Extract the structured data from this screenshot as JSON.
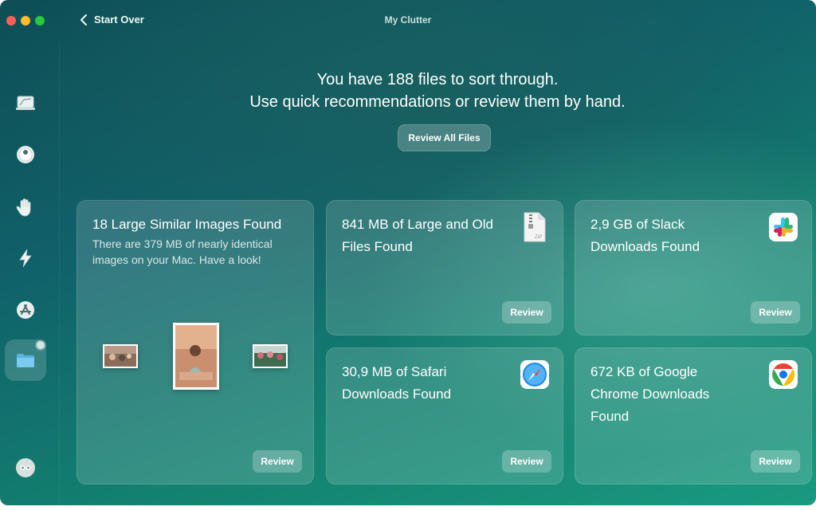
{
  "window": {
    "title": "My Clutter",
    "back_label": "Start Over"
  },
  "sidebar": {
    "items": [
      {
        "name": "smart-scan",
        "icon": "monitor-icon"
      },
      {
        "name": "cleanup",
        "icon": "disk-icon"
      },
      {
        "name": "protection",
        "icon": "hand-icon"
      },
      {
        "name": "performance",
        "icon": "bolt-icon"
      },
      {
        "name": "applications",
        "icon": "app-store-icon"
      },
      {
        "name": "my-clutter",
        "icon": "folder-icon",
        "active": true
      },
      {
        "name": "assistant",
        "icon": "assistant-icon"
      }
    ]
  },
  "header": {
    "line1": "You have 188 files to sort through.",
    "line2": "Use quick recommendations or review them by hand.",
    "review_all_label": "Review All Files"
  },
  "cards": [
    {
      "title": "18 Large Similar Images Found",
      "subtitle_line1": "There are 379 MB of nearly identical",
      "subtitle_line2": "images on your Mac. Have a look!",
      "button": "Review"
    },
    {
      "title_line1": "841 MB of Large and Old",
      "title_line2": "Files Found",
      "icon": "zip-file-icon",
      "button": "Review"
    },
    {
      "title_line1": "2,9 GB of Slack",
      "title_line2": "Downloads Found",
      "icon": "slack-icon",
      "button": "Review"
    },
    {
      "title_line1": "30,9 MB of Safari",
      "title_line2": "Downloads Found",
      "icon": "safari-icon",
      "button": "Review"
    },
    {
      "title_line1": "672 KB of Google",
      "title_line2": "Chrome Downloads",
      "title_line3": "Found",
      "icon": "chrome-icon",
      "button": "Review"
    }
  ],
  "colors": {
    "accent": "#138270",
    "text": "#ffffff"
  }
}
